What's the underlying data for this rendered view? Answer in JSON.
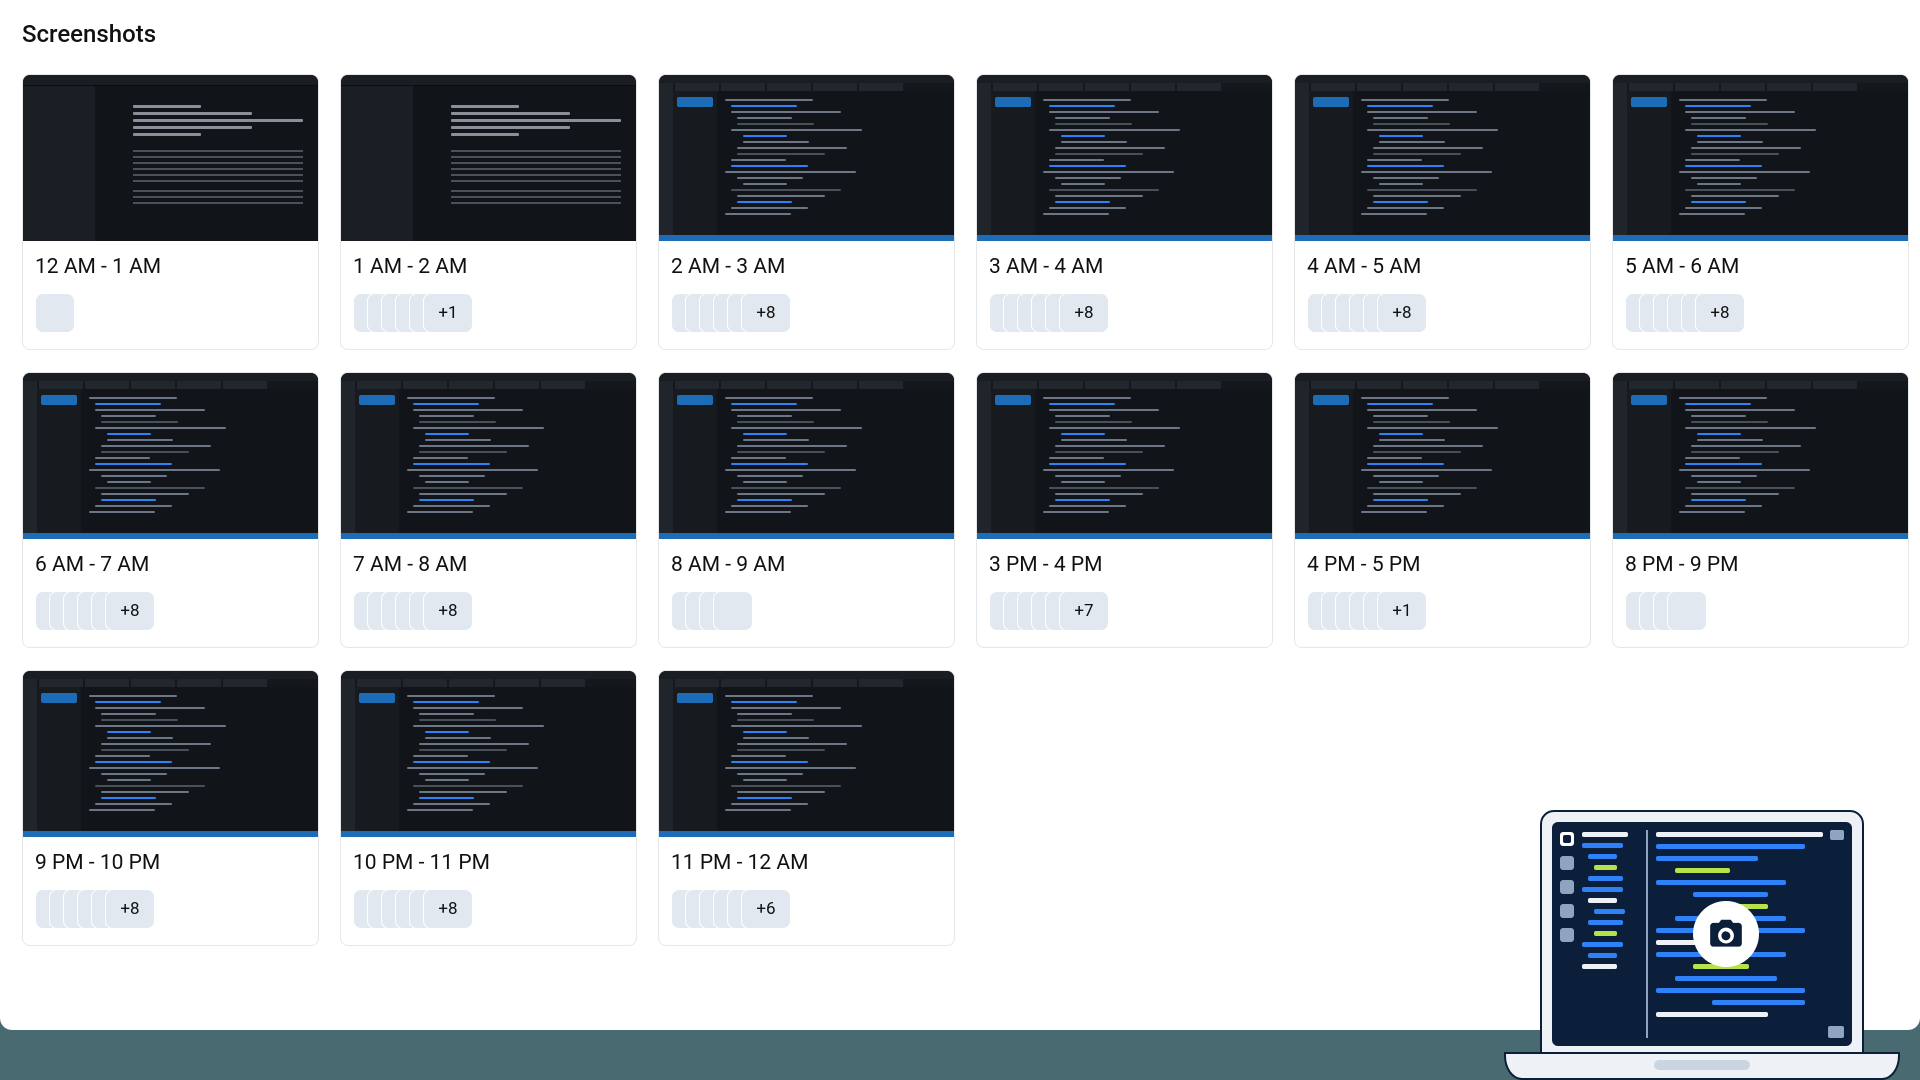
{
  "section_title": "Screenshots",
  "cards": [
    {
      "label": "12 AM - 1 AM",
      "variant": "a",
      "pills": 1,
      "more": null
    },
    {
      "label": "1 AM - 2 AM",
      "variant": "a",
      "pills": 5,
      "more": "+1"
    },
    {
      "label": "2 AM - 3 AM",
      "variant": "b",
      "pills": 5,
      "more": "+8"
    },
    {
      "label": "3 AM - 4 AM",
      "variant": "b",
      "pills": 5,
      "more": "+8"
    },
    {
      "label": "4 AM - 5 AM",
      "variant": "b",
      "pills": 5,
      "more": "+8"
    },
    {
      "label": "5 AM - 6 AM",
      "variant": "b",
      "pills": 5,
      "more": "+8"
    },
    {
      "label": "6 AM - 7 AM",
      "variant": "b",
      "pills": 5,
      "more": "+8"
    },
    {
      "label": "7 AM - 8 AM",
      "variant": "b",
      "pills": 5,
      "more": "+8"
    },
    {
      "label": "8 AM - 9 AM",
      "variant": "b",
      "pills": 4,
      "more": null
    },
    {
      "label": "3 PM - 4 PM",
      "variant": "b",
      "pills": 5,
      "more": "+7"
    },
    {
      "label": "4 PM - 5 PM",
      "variant": "b",
      "pills": 5,
      "more": "+1"
    },
    {
      "label": "8 PM - 9 PM",
      "variant": "b",
      "pills": 4,
      "more": null
    },
    {
      "label": "9 PM - 10 PM",
      "variant": "b",
      "pills": 5,
      "more": "+8"
    },
    {
      "label": "10 PM - 11 PM",
      "variant": "b",
      "pills": 5,
      "more": "+8"
    },
    {
      "label": "11 PM - 12 AM",
      "variant": "b",
      "pills": 5,
      "more": "+6"
    }
  ]
}
